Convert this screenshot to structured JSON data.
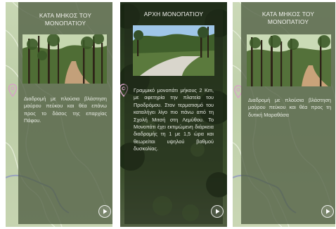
{
  "screens": [
    {
      "title_line1": "ΚΑΤΑ ΜΗΚΟΣ ΤΟΥ",
      "title_line2": "ΜΟΝΟΠΑΤΙΟΥ",
      "description": "Διαδρομή με πλούσια βλάστηση μαύρου πεύκου και θέα επάνω προς το δάσος της επαρχίας Πάφου.",
      "play_icon": "play-icon",
      "pin_icon": "map-pin-icon"
    },
    {
      "title": "ΑΡΧΗ ΜΟΝΟΠΑΤΙΟΥ",
      "description": "Γραμμικό μονοπάτι μήκους 2 Km, με αφετηρία την πλατεία του Προδρόμου. Στον τερματισμό του καταλήγει λίγο πιο πάνω από τη Σχολή Μιτσή στη Λεμύθου. Το Μονοπάτι έχει εκτιμώμενη διάρκεια διαδρομής τη 1 με 1,5 ώρα και θεωρείται υψηλού βαθμού δυσκολίας.",
      "play_icon": "play-icon",
      "pin_icon": "map-pin-icon"
    },
    {
      "title_line1": "ΚΑΤΑ ΜΗΚΟΣ ΤΟΥ",
      "title_line2": "ΜΟΝΟΠΑΤΙΟΥ",
      "description": "Διαδρομή με πλούσια βλάστηση μαύρου πεύκου και θέα προς τη δυτική Μαραθάσα",
      "play_icon": "play-icon",
      "pin_icon": "map-pin-icon"
    }
  ],
  "colors": {
    "panel_overlay": "#505e42",
    "map_background": "#c4d3ae",
    "forest_dark": "#20301a",
    "text_light": "#f2f2ee"
  }
}
